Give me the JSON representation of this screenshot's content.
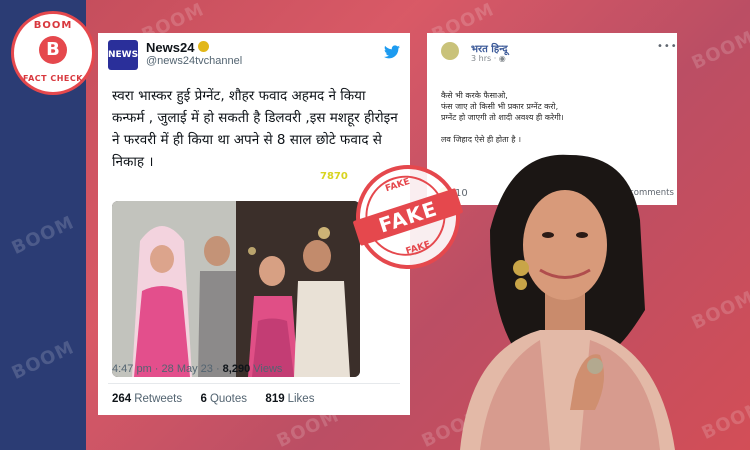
{
  "logo": {
    "top": "BOOM",
    "letter": "B",
    "bottom": "FACT CHECK"
  },
  "watermark": "BOOM",
  "tweet": {
    "name": "News24",
    "handle": "@news24tvchannel",
    "avatar_text": "NEWS 24",
    "logo_icon": "twitter-bird-icon",
    "text": "स्वरा भास्कर हुई प्रेग्नेंट, शौहर फवाद अहमद ने किया कन्फर्म , जुलाई में हो सकती है डिलवरी ,इस मशहूर हीरोइन ने फरवरी में ही किया था अपने से 8 साल छोटे फवाद से निकाह ।",
    "overlay_number": "7870",
    "meta": {
      "time": "4:47 pm · 28 May 23 · ",
      "views_count": "8,290",
      "views_label": " Views"
    },
    "stats": [
      {
        "count": "264",
        "label": "Retweets"
      },
      {
        "count": "6",
        "label": "Quotes"
      },
      {
        "count": "819",
        "label": "Likes"
      }
    ]
  },
  "facebook": {
    "name": "भरत हिन्दू",
    "time": "3 hrs · ",
    "lines": [
      "कैसे भी करके फैसाओ,",
      "फंस जाए तो किसी भी प्रकार प्रग्नेंट करो,",
      "प्रग्नेंट हो जाएगी तो शादी अवश्य ही करेगी।",
      "",
      "लव जिहाद ऐसे ही होता है ।"
    ],
    "reactions": "10",
    "comments": "4 comments"
  },
  "stamp": {
    "ring_text": "FAKE",
    "band_text": "FAKE"
  },
  "colors": {
    "brand_red": "#e5484d",
    "navy": "#2b3c74",
    "twitter_blue": "#1d9bf0",
    "fb_blue": "#3b5998"
  }
}
